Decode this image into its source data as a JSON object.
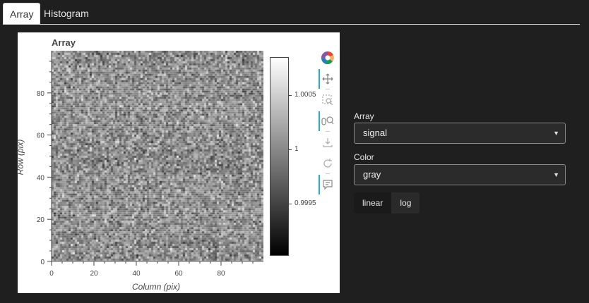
{
  "tabs": [
    {
      "label": "Array",
      "active": true
    },
    {
      "label": "Histogram",
      "active": false
    }
  ],
  "plot": {
    "title": "Array",
    "xlabel": "Column (pix)",
    "ylabel": "Row (pix)",
    "x_ticks": [
      "0",
      "20",
      "40",
      "60",
      "80"
    ],
    "y_ticks": [
      "0",
      "20",
      "40",
      "60",
      "80"
    ],
    "colorbar_ticks": [
      "1.0005",
      "1",
      "0.9995"
    ],
    "colormap": "gray"
  },
  "toolbar": {
    "tools": [
      "bokeh-logo-icon",
      "pan-icon",
      "box-zoom-icon",
      "wheel-zoom-icon",
      "save-icon",
      "reset-icon",
      "hover-icon"
    ]
  },
  "controls": {
    "array_label": "Array",
    "array_value": "signal",
    "color_label": "Color",
    "color_value": "gray",
    "scale_options": [
      "linear",
      "log"
    ],
    "scale_selected": "linear"
  },
  "colors": {
    "background": "#1f1f1f",
    "panel": "#ffffff",
    "toolbar_active": "#26aae1"
  }
}
